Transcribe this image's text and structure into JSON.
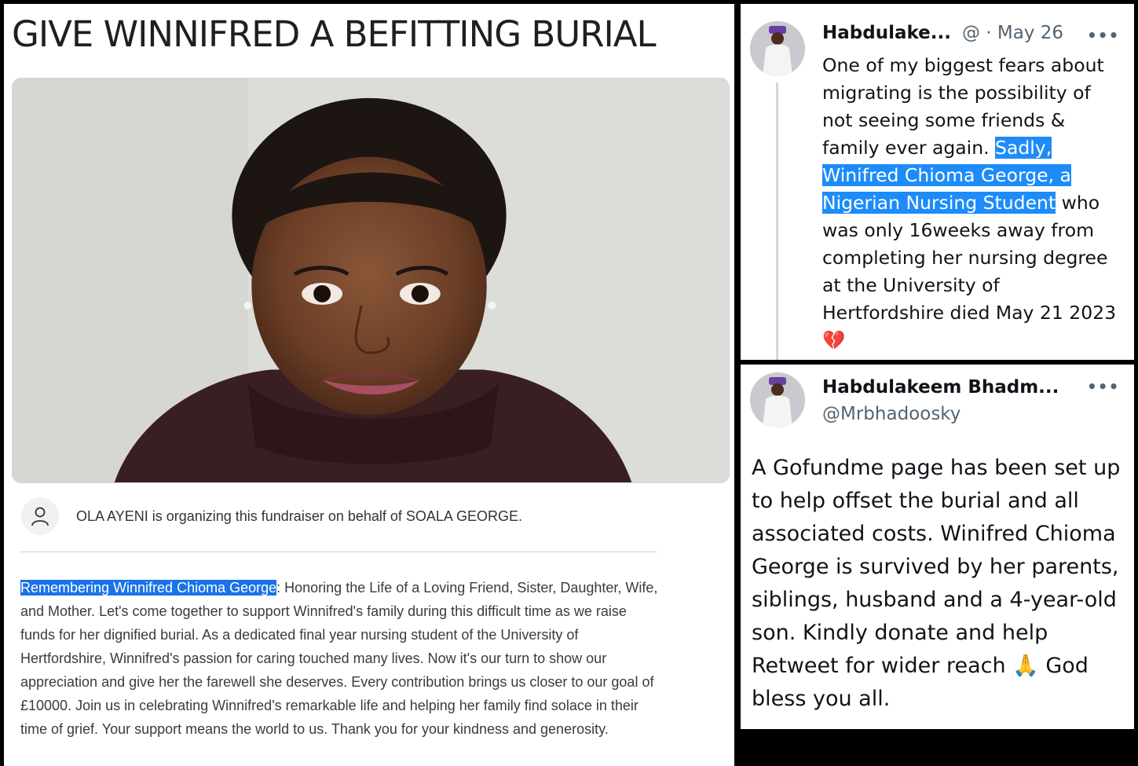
{
  "fundraiser": {
    "title": "GIVE WINNIFRED A BEFITTING BURIAL",
    "organizer_text": "OLA AYENI is organizing this fundraiser on behalf of SOALA GEORGE.",
    "story_highlight": "Remembering Winnifred Chioma George",
    "story_rest": ": Honoring the Life of a Loving Friend, Sister, Daughter, Wife, and Mother. Let's come together to support Winnifred's family during this difficult time as we raise funds for her dignified burial. As a dedicated final year nursing student of the University of Hertfordshire, Winnifred's passion for caring touched many lives. Now it's our turn to show our appreciation and give her the farewell she deserves. Every contribution brings us closer to our goal of £10000. Join us in celebrating Winnifred's remarkable life and helping her family find solace in their time of grief. Your support means the world to us. Thank you for your kindness and generosity."
  },
  "tweet1": {
    "name": "Habdulake...",
    "meta": "@ · May 26",
    "more": "•••",
    "text_before": "One of my biggest fears about migrating is the possibility of not seeing some friends & family ever again. ",
    "text_highlight": "Sadly, Winifred Chioma George, a Nigerian Nursing Student",
    "text_after": " who was only 16weeks away from completing her nursing degree at the University of Hertfordshire died May 21 2023 ",
    "emoji": "💔"
  },
  "tweet2": {
    "name": "Habdulakeem Bhadm...",
    "handle": "@Mrbhadoosky",
    "more": "•••",
    "text": "A Gofundme page has been  set up to help offset the burial and all associated costs. Winifred Chioma George is survived by her parents, siblings, husband and a 4-year-old son. Kindly donate and help Retweet for wider reach ",
    "emoji": "🙏",
    "text_end": " God bless you all."
  },
  "colors": {
    "highlight": "#1a73e8",
    "twitter_text": "#0f1419",
    "twitter_meta": "#536471"
  }
}
